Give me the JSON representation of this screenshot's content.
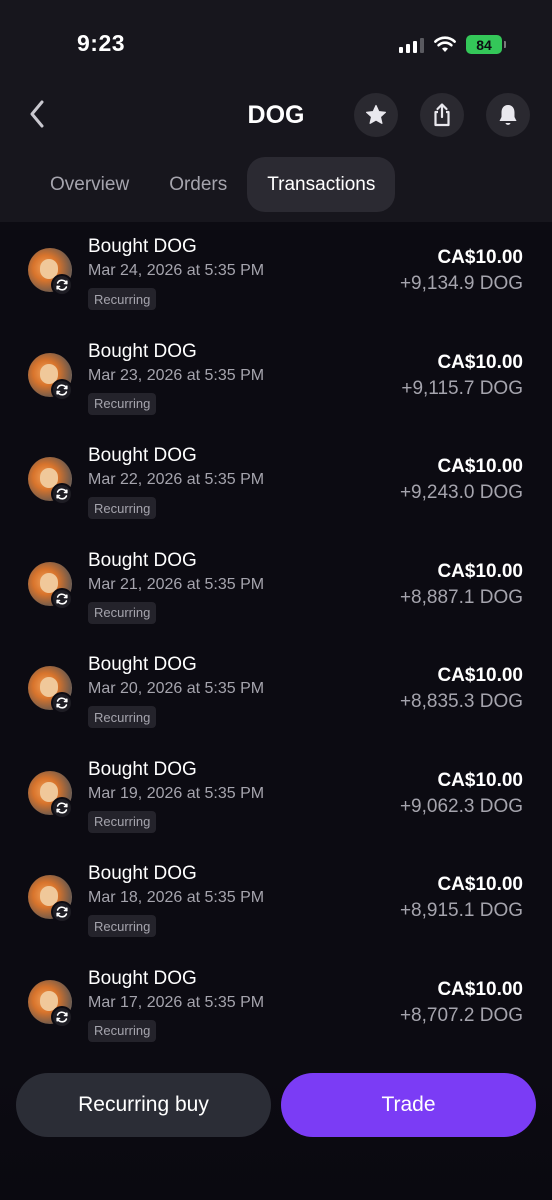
{
  "status_bar": {
    "time": "9:23",
    "battery": "84"
  },
  "header": {
    "title": "DOG",
    "back_icon": "chevron-left-icon",
    "star_icon": "star-icon",
    "share_icon": "share-icon",
    "bell_icon": "bell-icon"
  },
  "tabs": [
    {
      "label": "Overview",
      "active": false
    },
    {
      "label": "Orders",
      "active": false
    },
    {
      "label": "Transactions",
      "active": true
    }
  ],
  "transactions": [
    {
      "title": "Bought DOG",
      "date": "Mar 24, 2026 at 5:35 PM",
      "badge": "Recurring",
      "amount": "CA$10.00",
      "qty": "+9,134.9 DOG"
    },
    {
      "title": "Bought DOG",
      "date": "Mar 23, 2026 at 5:35 PM",
      "badge": "Recurring",
      "amount": "CA$10.00",
      "qty": "+9,115.7 DOG"
    },
    {
      "title": "Bought DOG",
      "date": "Mar 22, 2026 at 5:35 PM",
      "badge": "Recurring",
      "amount": "CA$10.00",
      "qty": "+9,243.0 DOG"
    },
    {
      "title": "Bought DOG",
      "date": "Mar 21, 2026 at 5:35 PM",
      "badge": "Recurring",
      "amount": "CA$10.00",
      "qty": "+8,887.1 DOG"
    },
    {
      "title": "Bought DOG",
      "date": "Mar 20, 2026 at 5:35 PM",
      "badge": "Recurring",
      "amount": "CA$10.00",
      "qty": "+8,835.3 DOG"
    },
    {
      "title": "Bought DOG",
      "date": "Mar 19, 2026 at 5:35 PM",
      "badge": "Recurring",
      "amount": "CA$10.00",
      "qty": "+9,062.3 DOG"
    },
    {
      "title": "Bought DOG",
      "date": "Mar 18, 2026 at 5:35 PM",
      "badge": "Recurring",
      "amount": "CA$10.00",
      "qty": "+8,915.1 DOG"
    },
    {
      "title": "Bought DOG",
      "date": "Mar 17, 2026 at 5:35 PM",
      "badge": "Recurring",
      "amount": "CA$10.00",
      "qty": "+8,707.2 DOG"
    }
  ],
  "actions": {
    "recurring_buy": "Recurring buy",
    "trade": "Trade"
  },
  "colors": {
    "background": "#0c0b12",
    "accent": "#7b3cf5",
    "battery": "#34c759"
  }
}
